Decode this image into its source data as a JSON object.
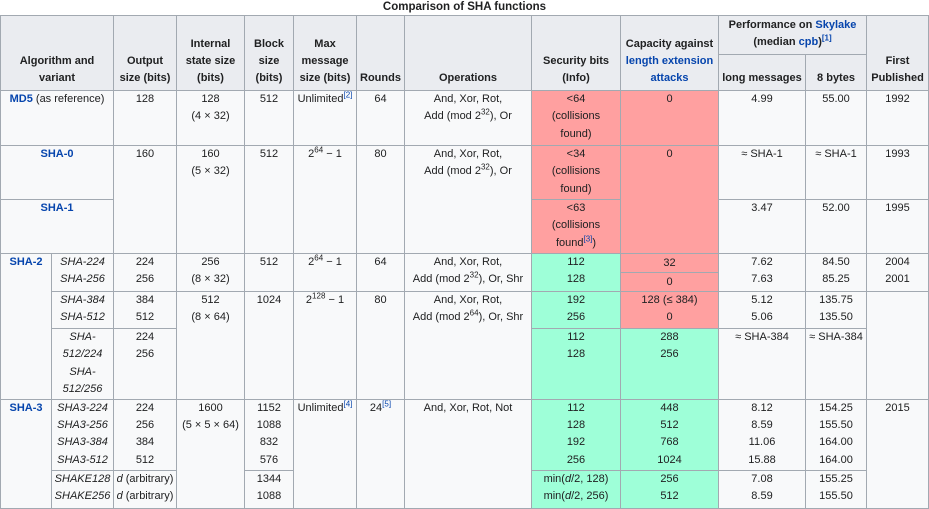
{
  "caption": "Comparison of SHA functions",
  "headers": {
    "algorithm": "Algorithm and variant",
    "output": "Output size (bits)",
    "internal": "Internal state size (bits)",
    "block": "Block size (bits)",
    "maxmsg_l1": "Max",
    "maxmsg_l2": "message size (bits)",
    "rounds": "Rounds",
    "operations": "Operations",
    "security_l1": "Security bits",
    "security_l2": "(Info)",
    "capacity_l1": "Capacity against",
    "capacity_link": "length extension attacks",
    "perf_l1": "Performance on",
    "perf_link": "Skylake",
    "perf_l2": "(median",
    "perf_cpb": "cpb",
    "perf_l3": ")",
    "perf_ref": "[1]",
    "perf_long": "long messages",
    "perf_8": "8 bytes",
    "first": "First Published"
  },
  "md5": {
    "name": "MD5",
    "note": "(as reference)",
    "output": "128",
    "internal_1": "128",
    "internal_2": "(4 × 32)",
    "block": "512",
    "maxmsg": "Unlimited",
    "maxmsg_ref": "[2]",
    "rounds": "64",
    "ops_1": "And, Xor, Rot,",
    "ops_2a": "Add (mod 2",
    "ops_2exp": "32",
    "ops_2b": "), Or",
    "sec_1": "<64",
    "sec_2": "(collisions",
    "sec_3": "found)",
    "capacity": "0",
    "perf_long": "4.99",
    "perf_8": "55.00",
    "first": "1992"
  },
  "sha0": {
    "name": "SHA-0",
    "output": "160",
    "internal_1": "160",
    "internal_2": "(5 × 32)",
    "block": "512",
    "maxmsg_base": "2",
    "maxmsg_exp": "64",
    "maxmsg_rest": " − 1",
    "rounds": "80",
    "ops_1": "And, Xor, Rot,",
    "ops_2a": "Add (mod 2",
    "ops_2exp": "32",
    "ops_2b": "), Or",
    "sec_1": "<34",
    "sec_2": "(collisions",
    "sec_3": "found)",
    "capacity": "0",
    "perf_long": "≈ SHA-1",
    "perf_8": "≈ SHA-1",
    "first": "1993"
  },
  "sha1": {
    "name": "SHA-1",
    "sec_1": "<63",
    "sec_2": "(collisions",
    "sec_3": "found",
    "sec_ref": "[3]",
    "sec_4": ")",
    "perf_long": "3.47",
    "perf_8": "52.00",
    "first": "1995"
  },
  "sha2": {
    "family": "SHA-2",
    "sha224": "SHA-224",
    "sha256": "SHA-256",
    "out224": "224",
    "out256": "256",
    "int256_1": "256",
    "int256_2": "(8 × 32)",
    "block256": "512",
    "max256_base": "2",
    "max256_exp": "64",
    "max256_rest": " − 1",
    "rounds256": "64",
    "ops256_1": "And, Xor, Rot,",
    "ops256_2a": "Add (mod 2",
    "ops256_2exp": "32",
    "ops256_2b": "), Or, Shr",
    "sec224": "112",
    "sec256": "128",
    "cap224": "32",
    "cap256": "0",
    "pl224": "7.62",
    "pl256": "7.63",
    "p8_224": "84.50",
    "p8_256": "85.25",
    "fp224": "2004",
    "fp256": "2001",
    "sha384": "SHA-384",
    "sha512": "SHA-512",
    "out384": "384",
    "out512": "512",
    "int512_1": "512",
    "int512_2": "(8 × 64)",
    "block512": "1024",
    "max512_base": "2",
    "max512_exp": "128",
    "max512_rest": " − 1",
    "rounds512": "80",
    "ops512_1": "And, Xor, Rot,",
    "ops512_2a": "Add (mod 2",
    "ops512_2exp": "64",
    "ops512_2b": "), Or, Shr",
    "sec384": "192",
    "sec512": "256",
    "cap384": "128 (≤ 384)",
    "cap512": "0",
    "pl384": "5.12",
    "pl512": "5.06",
    "p8_384": "135.75",
    "p8_512": "135.50",
    "sha512_224": "SHA-512/224",
    "sha512_256": "SHA-512/256",
    "out512_224": "224",
    "out512_256": "256",
    "sec512_224": "112",
    "sec512_256": "128",
    "cap512_224": "288",
    "cap512_256": "256",
    "pl512t": "≈ SHA-384",
    "p8_512t": "≈ SHA-384"
  },
  "sha3": {
    "family": "SHA-3",
    "v1": "SHA3-224",
    "v2": "SHA3-256",
    "v3": "SHA3-384",
    "v4": "SHA3-512",
    "o1": "224",
    "o2": "256",
    "o3": "384",
    "o4": "512",
    "int_1": "1600",
    "int_2": "(5 × 5 × 64)",
    "b1": "1152",
    "b2": "1088",
    "b3": "832",
    "b4": "576",
    "maxmsg": "Unlimited",
    "maxmsg_ref": "[4]",
    "rounds": "24",
    "rounds_ref": "[5]",
    "ops": "And, Xor, Rot, Not",
    "s1": "112",
    "s2": "128",
    "s3": "192",
    "s4": "256",
    "c1": "448",
    "c2": "512",
    "c3": "768",
    "c4": "1024",
    "pl1": "8.12",
    "pl2": "8.59",
    "pl3": "11.06",
    "pl4": "15.88",
    "p81": "154.25",
    "p82": "155.50",
    "p83": "164.00",
    "p84": "164.00",
    "first": "2015",
    "shake128": "SHAKE128",
    "shake256": "SHAKE256",
    "shake_out_d": "d",
    "shake_out_rest": " (arbitrary)",
    "sb128": "1344",
    "sb256": "1088",
    "ss128_a": "min(",
    "ss128_d": "d",
    "ss128_b": "/2, 128)",
    "ss256_a": "min(",
    "ss256_d": "d",
    "ss256_b": "/2, 256)",
    "sc128": "256",
    "sc256": "512",
    "spl128": "7.08",
    "spl256": "8.59",
    "sp8128": "155.25",
    "sp8256": "155.50"
  },
  "colors": {
    "red": "#ffa0a0",
    "green": "#9effd8",
    "header": "#eaecf0",
    "cell": "#f8f9fa",
    "link": "#0645ad"
  }
}
